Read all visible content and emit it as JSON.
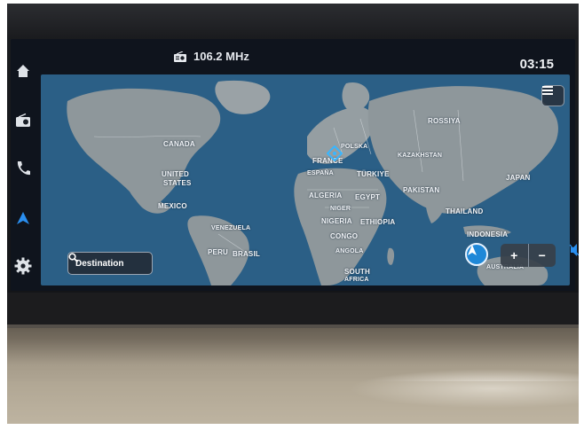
{
  "status_bar": {
    "source_icon": "radio-icon",
    "frequency": "106.2 MHz",
    "time": "03:15"
  },
  "side_rail": {
    "items": [
      {
        "icon": "home-icon"
      },
      {
        "icon": "radio-icon"
      },
      {
        "icon": "phone-icon"
      },
      {
        "icon": "navigation-icon",
        "active": true
      },
      {
        "icon": "gear-icon"
      }
    ]
  },
  "map": {
    "labels": [
      "CANADA",
      "UNITED",
      "STATES",
      "MEXICO",
      "VENEZUELA",
      "PERU",
      "BRASIL",
      "ROSSIYA",
      "POLSKA",
      "FRANCE",
      "ESPAÑA",
      "TÜRKIYE",
      "KAZAKHSTAN",
      "JAPAN",
      "ALGERIA",
      "EGYPT",
      "PAKISTAN",
      "NIGER",
      "NIGERIA",
      "ETHIOPIA",
      "THAILAND",
      "CONGO",
      "INDONESIA",
      "ANGOLA",
      "SOUTH",
      "AFRICA",
      "AUSTRALIA"
    ]
  },
  "controls": {
    "menu_icon": "menu-icon",
    "destination_label": "Destination",
    "search_icon": "search-icon",
    "compass_icon": "compass-icon",
    "zoom_in_label": "+",
    "zoom_out_label": "−"
  },
  "colors": {
    "ocean": "#2b5f86",
    "land": "#8e979b",
    "active_accent": "#1f88d8",
    "screen_bg": "#0f141d"
  }
}
